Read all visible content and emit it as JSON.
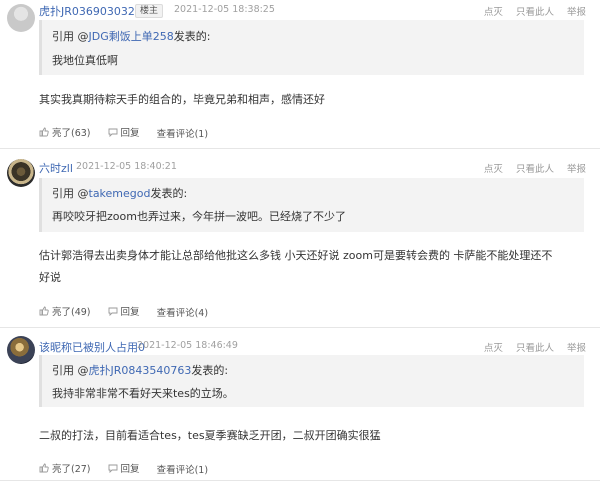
{
  "actions": {
    "like": "点灭",
    "hide": "只看此人",
    "report": "举报"
  },
  "posts": [
    {
      "username": "虎扑JR0369030326",
      "badge": "楼主",
      "time": "2021-12-05 18:38:25",
      "quote_prefix": "引用 @",
      "quote_user": "JDG剩饭上单258",
      "quote_suffix": "发表的:",
      "quote_text": "我地位真低啊",
      "content": "其实我真期待粽天手的组合的，毕竟兄弟和相声，感情还好",
      "likes_label": "亮了(63)",
      "reply_label": "回复",
      "view_label": "查看评论(1)"
    },
    {
      "username": "六时zll",
      "time": "2021-12-05 18:40:21",
      "quote_prefix": "引用 @",
      "quote_user": "takemegod",
      "quote_suffix": "发表的:",
      "quote_text": "再咬咬牙把zoom也弄过来，今年拼一波吧。已经烧了不少了",
      "content": "估计郭浩得去出卖身体才能让总部给他批这么多钱 小天还好说 zoom可是要转会费的 卡萨能不能处理还不好说",
      "likes_label": "亮了(49)",
      "reply_label": "回复",
      "view_label": "查看评论(4)"
    },
    {
      "username": "该昵称已被别人占用0",
      "time": "2021-12-05 18:46:49",
      "quote_prefix": "引用 @",
      "quote_user": "虎扑JR0843540763",
      "quote_suffix": "发表的:",
      "quote_text": "我持非常非常不看好天来tes的立场。",
      "content": "二叔的打法，目前看适合tes，tes夏季赛缺乏开团，二叔开团确实很猛",
      "likes_label": "亮了(27)",
      "reply_label": "回复",
      "view_label": "查看评论(1)"
    }
  ]
}
